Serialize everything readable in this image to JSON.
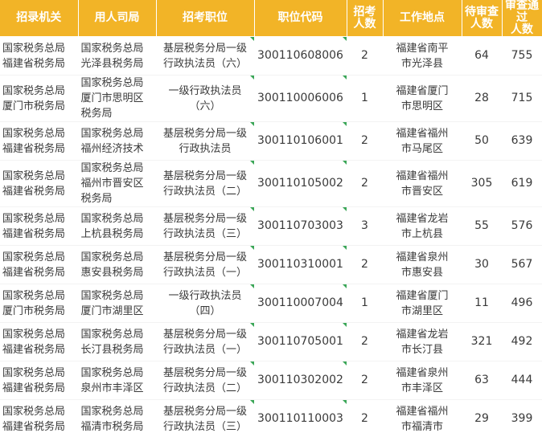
{
  "headers": {
    "recruit_org": "招录机关",
    "employer": "用人司局",
    "position": "招考职位",
    "position_code": "职位代码",
    "quota": "招考\n人数",
    "location": "工作地点",
    "pending": "待审查\n人数",
    "passed": "审查通过\n人数"
  },
  "rows": [
    {
      "org": "国家税务总局\n福建省税务局",
      "employer": "国家税务总局\n光泽县税务局",
      "position": "基层税务分局一级\n行政执法员（六）",
      "code": "300110608006",
      "quota": "2",
      "location": "福建省南平\n市光泽县",
      "pending": "64",
      "passed": "755"
    },
    {
      "org": "国家税务总局\n厦门市税务局",
      "employer": "国家税务总局\n厦门市思明区\n税务局",
      "position": "一级行政执法员\n（六）",
      "code": "300110006006",
      "quota": "1",
      "location": "福建省厦门\n市思明区",
      "pending": "28",
      "passed": "715"
    },
    {
      "org": "国家税务总局\n福建省税务局",
      "employer": "国家税务总局\n福州经济技术",
      "position": "基层税务分局一级\n行政执法员",
      "code": "300110106001",
      "quota": "2",
      "location": "福建省福州\n市马尾区",
      "pending": "50",
      "passed": "639"
    },
    {
      "org": "国家税务总局\n福建省税务局",
      "employer": "国家税务总局\n福州市晋安区\n税务局",
      "position": "基层税务分局一级\n行政执法员（二）",
      "code": "300110105002",
      "quota": "2",
      "location": "福建省福州\n市晋安区",
      "pending": "305",
      "passed": "619"
    },
    {
      "org": "国家税务总局\n福建省税务局",
      "employer": "国家税务总局\n上杭县税务局",
      "position": "基层税务分局一级\n行政执法员（三）",
      "code": "300110703003",
      "quota": "3",
      "location": "福建省龙岩\n市上杭县",
      "pending": "55",
      "passed": "576"
    },
    {
      "org": "国家税务总局\n福建省税务局",
      "employer": "国家税务总局\n惠安县税务局",
      "position": "基层税务分局一级\n行政执法员（一）",
      "code": "300110310001",
      "quota": "2",
      "location": "福建省泉州\n市惠安县",
      "pending": "30",
      "passed": "567"
    },
    {
      "org": "国家税务总局\n厦门市税务局",
      "employer": "国家税务总局\n厦门市湖里区",
      "position": "一级行政执法员\n（四）",
      "code": "300110007004",
      "quota": "1",
      "location": "福建省厦门\n市湖里区",
      "pending": "11",
      "passed": "496"
    },
    {
      "org": "国家税务总局\n福建省税务局",
      "employer": "国家税务总局\n长汀县税务局",
      "position": "基层税务分局一级\n行政执法员（一）",
      "code": "300110705001",
      "quota": "2",
      "location": "福建省龙岩\n市长汀县",
      "pending": "321",
      "passed": "492"
    },
    {
      "org": "国家税务总局\n福建省税务局",
      "employer": "国家税务总局\n泉州市丰泽区",
      "position": "基层税务分局一级\n行政执法员（二）",
      "code": "300110302002",
      "quota": "2",
      "location": "福建省泉州\n市丰泽区",
      "pending": "63",
      "passed": "444"
    },
    {
      "org": "国家税务总局\n福建省税务局",
      "employer": "国家税务总局\n福清市税务局",
      "position": "基层税务分局一级\n行政执法员（三）",
      "code": "300110110003",
      "quota": "2",
      "location": "福建省福州\n市福清市",
      "pending": "29",
      "passed": "399"
    }
  ],
  "colors": {
    "header_bg": "#f2b427",
    "header_text": "#ffffff",
    "marker": "#3aa657"
  }
}
